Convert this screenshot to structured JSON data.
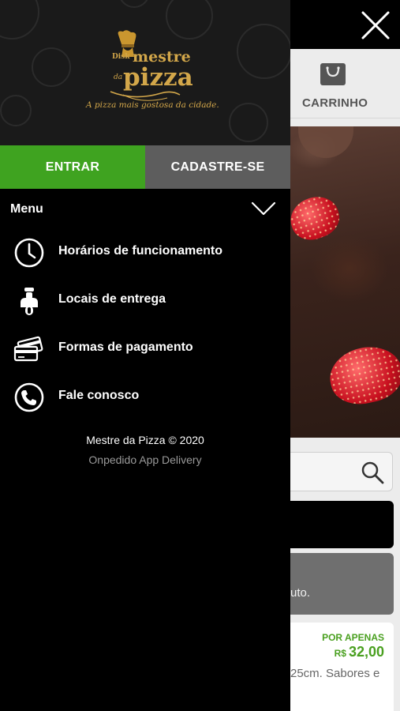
{
  "background_app": {
    "cart_label": "CARRINHO",
    "greybar_text": "uto.",
    "card": {
      "price_prefix": "POR APENAS",
      "currency": "R$",
      "price": "32,00",
      "description_fragment": "25cm. Sabores e"
    }
  },
  "drawer": {
    "logo": {
      "disk": "Disk",
      "brand_top": "mestre",
      "brand_da": "da",
      "brand_main": "pizza",
      "tagline": "A pizza mais gostosa da cidade."
    },
    "auth": {
      "login_label": "ENTRAR",
      "signup_label": "CADASTRE-SE"
    },
    "menu": {
      "title": "Menu",
      "items": [
        {
          "label": "Horários de funcionamento",
          "icon": "clock-icon"
        },
        {
          "label": "Locais de entrega",
          "icon": "scooter-icon"
        },
        {
          "label": "Formas de pagamento",
          "icon": "cards-icon"
        },
        {
          "label": "Fale conosco",
          "icon": "phone-icon"
        }
      ]
    },
    "footer": {
      "copyright": "Mestre da Pizza © 2020",
      "powered_by": "Onpedido App Delivery"
    }
  },
  "colors": {
    "accent_green": "#3fa320",
    "signup_grey": "#5d5d5d",
    "logo_gold": "#d3a74a"
  }
}
